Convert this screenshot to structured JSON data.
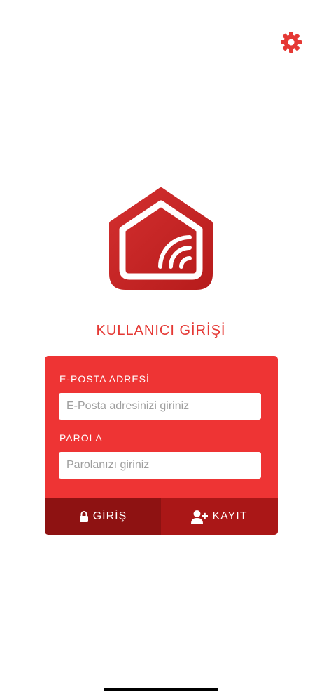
{
  "icons": {
    "settings": "gear-icon",
    "logo": "smart-home-logo",
    "login": "lock-icon",
    "register": "add-user-icon"
  },
  "colors": {
    "accent": "#e53935",
    "card": "#ee3434",
    "login_button": "#8e1212",
    "register_button": "#aa1717"
  },
  "title": "KULLANICI GİRİŞİ",
  "form": {
    "email_label": "E-POSTA ADRESİ",
    "email_placeholder": "E-Posta adresinizi giriniz",
    "email_value": "",
    "password_label": "PAROLA",
    "password_placeholder": "Parolanızı giriniz",
    "password_value": "",
    "login_label": "GİRİŞ",
    "register_label": "KAYIT"
  }
}
